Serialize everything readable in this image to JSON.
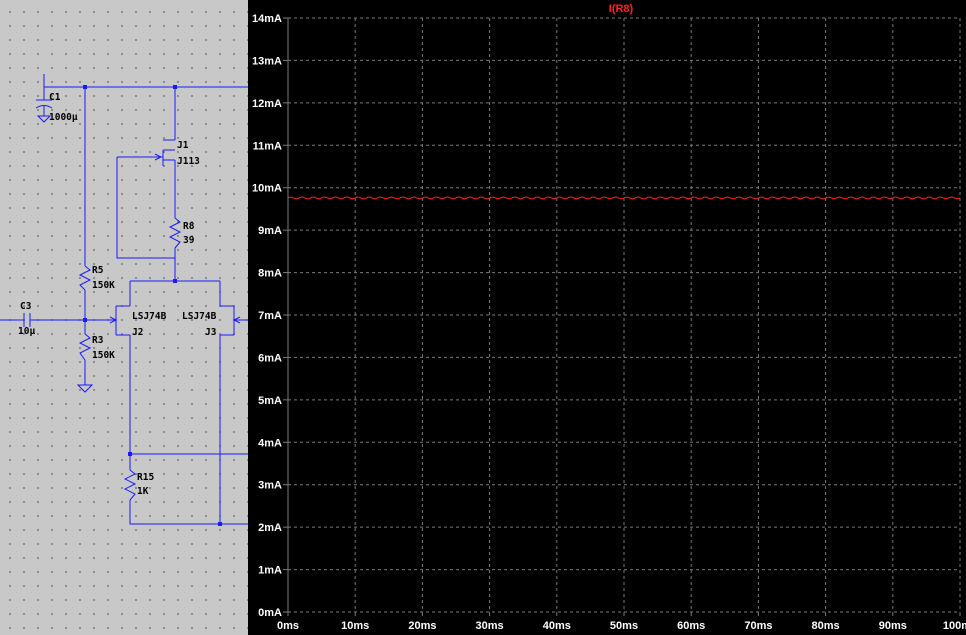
{
  "schematic": {
    "components": [
      {
        "ref": "C1",
        "value": "1000µ"
      },
      {
        "ref": "J1",
        "value": "J113"
      },
      {
        "ref": "R8",
        "value": "39"
      },
      {
        "ref": "R5",
        "value": "150K"
      },
      {
        "ref": "C3",
        "value": "10µ"
      },
      {
        "ref": "R3",
        "value": "150K"
      },
      {
        "ref": "J2",
        "value": "LSJ74B"
      },
      {
        "ref": "J3",
        "value": "LSJ74B"
      },
      {
        "ref": "R15",
        "value": "1K"
      }
    ]
  },
  "plot": {
    "title": "I(R8)",
    "colors": {
      "background": "#000000",
      "grid": "#7a7a7a",
      "trace": "#ff2020",
      "text": "#ffffff"
    }
  },
  "chart_data": {
    "type": "line",
    "title": "I(R8)",
    "xlabel": "",
    "ylabel": "",
    "xlim": [
      0,
      100
    ],
    "ylim": [
      0,
      14
    ],
    "x_ticks": [
      "0ms",
      "10ms",
      "20ms",
      "30ms",
      "40ms",
      "50ms",
      "60ms",
      "70ms",
      "80ms",
      "90ms",
      "100ms"
    ],
    "y_ticks": [
      "0mA",
      "1mA",
      "2mA",
      "3mA",
      "4mA",
      "5mA",
      "6mA",
      "7mA",
      "8mA",
      "9mA",
      "10mA",
      "11mA",
      "12mA",
      "13mA",
      "14mA"
    ],
    "grid": true,
    "series": [
      {
        "name": "I(R8)",
        "color": "#ff2020",
        "x": [
          0,
          10,
          20,
          30,
          40,
          50,
          60,
          70,
          80,
          90,
          100
        ],
        "y": [
          9.76,
          9.76,
          9.76,
          9.76,
          9.76,
          9.76,
          9.76,
          9.76,
          9.76,
          9.76,
          9.76
        ],
        "ripple_amplitude": 0.02,
        "ripple_cycles": 60
      }
    ]
  }
}
